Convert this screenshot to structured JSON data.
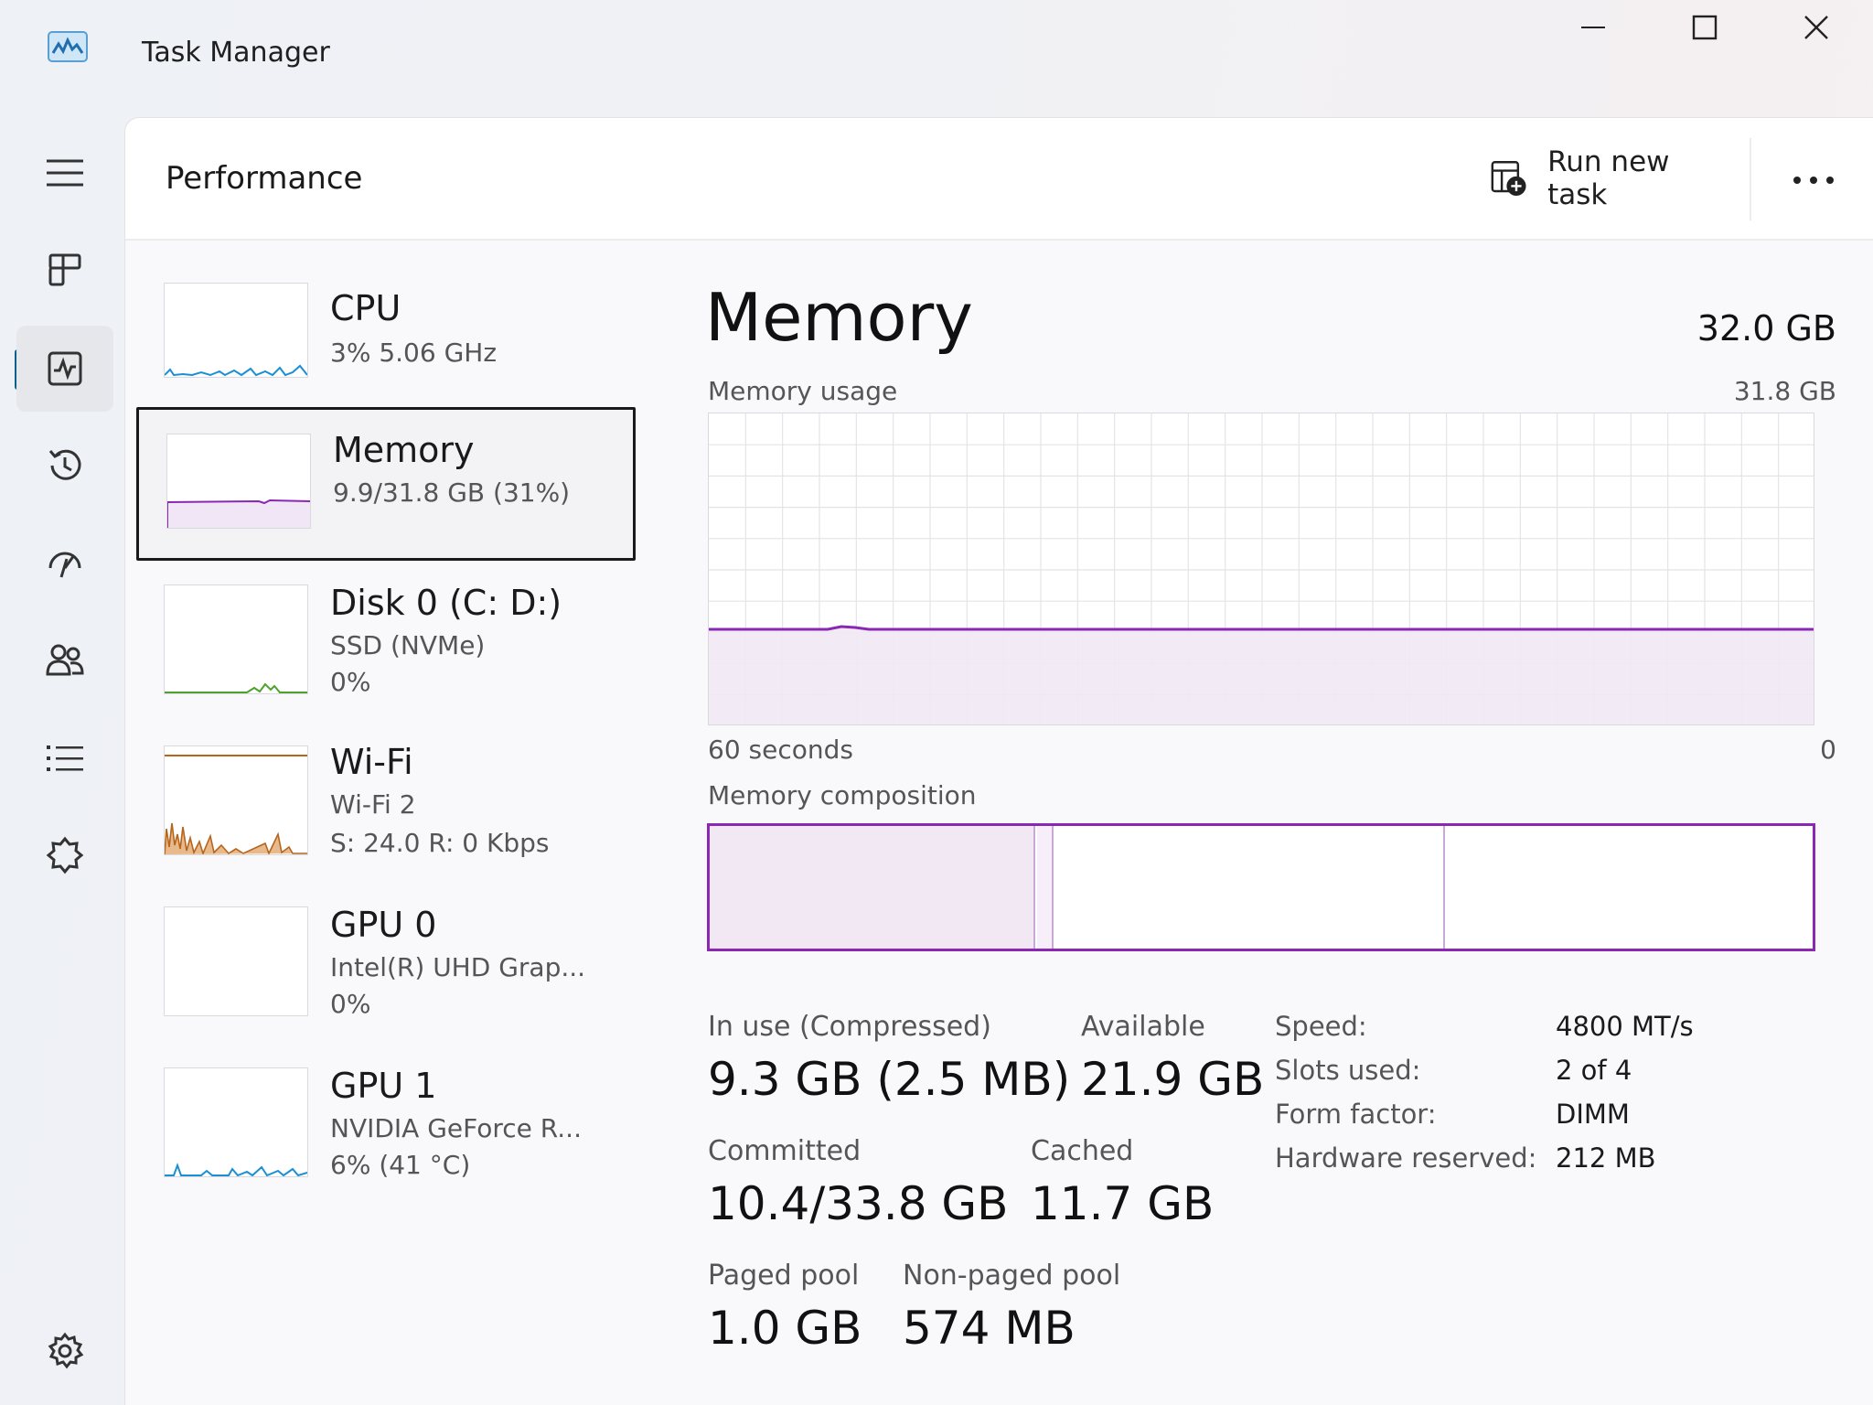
{
  "window": {
    "title": "Task Manager",
    "icon": "task-manager-icon",
    "controls": [
      "minimize-icon",
      "maximize-icon",
      "close-icon"
    ]
  },
  "nav": {
    "items": [
      {
        "name": "hamburger-menu-icon"
      },
      {
        "name": "processes-icon"
      },
      {
        "name": "performance-icon",
        "active": true
      },
      {
        "name": "app-history-icon"
      },
      {
        "name": "startup-apps-icon"
      },
      {
        "name": "users-icon"
      },
      {
        "name": "details-icon"
      },
      {
        "name": "services-icon"
      },
      {
        "name": "settings-icon"
      }
    ]
  },
  "header": {
    "title": "Performance",
    "run_new_task": "Run new task",
    "more_icon": "more-options-icon"
  },
  "resources": [
    {
      "name": "CPU",
      "line1": "3%  5.06 GHz",
      "line2": "",
      "color": "#1a8fd6"
    },
    {
      "name": "Memory",
      "line1": "9.9/31.8 GB (31%)",
      "line2": "",
      "color": "#8b28b3",
      "selected": true
    },
    {
      "name": "Disk 0 (C: D:)",
      "line1": "SSD (NVMe)",
      "line2": "0%",
      "color": "#4ca32c"
    },
    {
      "name": "Wi-Fi",
      "line1": "Wi-Fi 2",
      "line2": "S: 24.0  R: 0 Kbps",
      "color": "#b5651d"
    },
    {
      "name": "GPU 0",
      "line1": "Intel(R) UHD Grap...",
      "line2": "0%",
      "color": "#1a8fd6"
    },
    {
      "name": "GPU 1",
      "line1": "NVIDIA GeForce R...",
      "line2": "6%  (41 °C)",
      "color": "#1a8fd6"
    }
  ],
  "detail": {
    "title": "Memory",
    "total": "32.0 GB",
    "usage_label": "Memory usage",
    "usage_max": "31.8 GB",
    "time_label": "60 seconds",
    "time_end": "0",
    "usage_fraction": 0.31,
    "composition_label": "Memory composition",
    "accent": "#8b28b3",
    "stats": {
      "in_use_label": "In use (Compressed)",
      "in_use_value": "9.3 GB (2.5 MB)",
      "available_label": "Available",
      "available_value": "21.9 GB",
      "committed_label": "Committed",
      "committed_value": "10.4/33.8 GB",
      "cached_label": "Cached",
      "cached_value": "11.7 GB",
      "paged_label": "Paged pool",
      "paged_value": "1.0 GB",
      "nonpaged_label": "Non-paged pool",
      "nonpaged_value": "574 MB"
    },
    "specs": [
      {
        "label": "Speed:",
        "value": "4800 MT/s"
      },
      {
        "label": "Slots used:",
        "value": "2 of 4"
      },
      {
        "label": "Form factor:",
        "value": "DIMM"
      },
      {
        "label": "Hardware reserved:",
        "value": "212 MB"
      }
    ]
  }
}
